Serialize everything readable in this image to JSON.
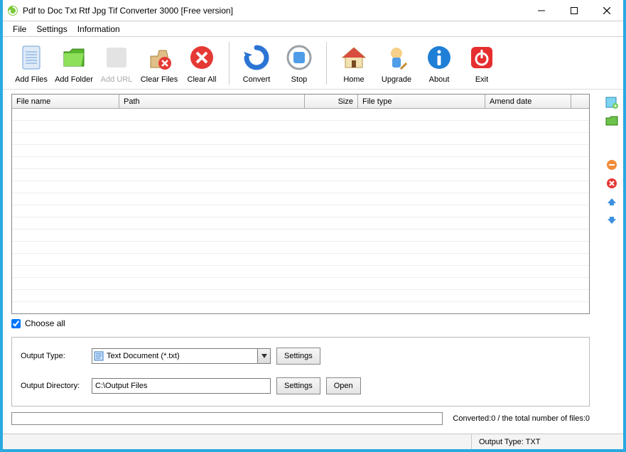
{
  "window": {
    "title": "Pdf to Doc Txt Rtf Jpg Tif Converter 3000 [Free version]"
  },
  "menu": {
    "items": [
      "File",
      "Settings",
      "Information"
    ]
  },
  "toolbar": {
    "add_files": "Add Files",
    "add_folder": "Add Folder",
    "add_url": "Add URL",
    "clear_files": "Clear Files",
    "clear_all": "Clear All",
    "convert": "Convert",
    "stop": "Stop",
    "home": "Home",
    "upgrade": "Upgrade",
    "about": "About",
    "exit": "Exit"
  },
  "table": {
    "columns": {
      "file_name": "File name",
      "path": "Path",
      "size": "Size",
      "file_type": "File type",
      "amend_date": "Amend date"
    },
    "widths": {
      "file_name": 151,
      "path": 261,
      "size": 75,
      "file_type": 179,
      "amend_date": 121,
      "last": 24
    },
    "rows": []
  },
  "choose_all": {
    "label": "Choose all",
    "checked": true
  },
  "output": {
    "type_label": "Output Type:",
    "type_value": "Text Document (*.txt)",
    "settings_label": "Settings",
    "directory_label": "Output Directory:",
    "directory_value": "C:\\Output Files",
    "open_label": "Open"
  },
  "status": {
    "text": "Converted:0  /  the total number of files:0"
  },
  "footer": {
    "output_type": "Output Type: TXT"
  }
}
